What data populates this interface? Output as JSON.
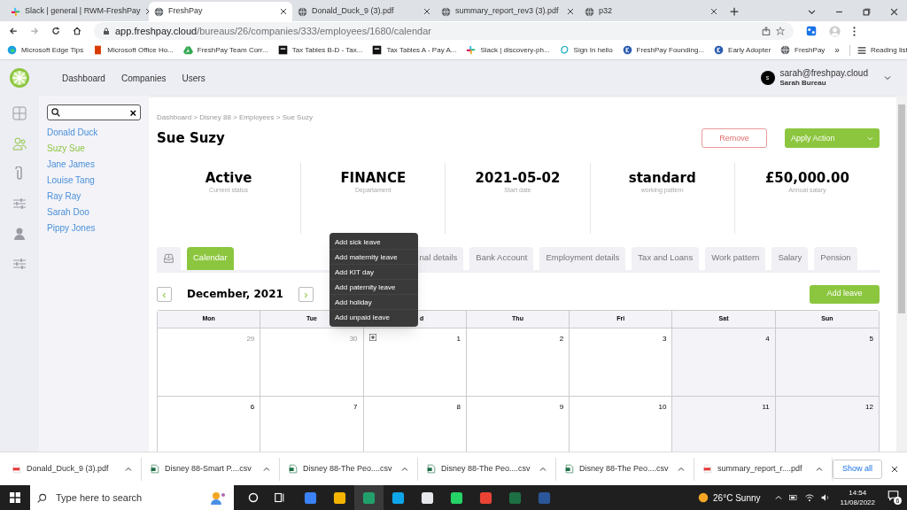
{
  "browser": {
    "tabs": [
      {
        "title": "Slack | general | RWM-FreshPay",
        "kind": "slack",
        "selected": false
      },
      {
        "title": "FreshPay",
        "kind": "globe",
        "selected": true
      },
      {
        "title": "Donald_Duck_9 (3).pdf",
        "kind": "globe",
        "selected": false
      },
      {
        "title": "summary_report_rev3 (3).pdf",
        "kind": "globe",
        "selected": false
      },
      {
        "title": "p32",
        "kind": "globe",
        "selected": false
      }
    ],
    "url_host": "app.freshpay.cloud",
    "url_path": "/bureaus/26/companies/333/employees/1680/calendar",
    "bookmarks": [
      {
        "label": "Microsoft Edge Tips",
        "kind": "edge"
      },
      {
        "label": "Microsoft Office Ho...",
        "kind": "office"
      },
      {
        "label": "FreshPay Team Corr...",
        "kind": "drive"
      },
      {
        "label": "Tax Tables B-D - Tax...",
        "kind": "dark"
      },
      {
        "label": "Tax Tables A - Pay A...",
        "kind": "dark"
      },
      {
        "label": "Slack | discovery-ph...",
        "kind": "slack"
      },
      {
        "label": "Sign In hello",
        "kind": "hello"
      },
      {
        "label": "FreshPay Founding...",
        "kind": "k"
      },
      {
        "label": "Early Adopter",
        "kind": "k"
      },
      {
        "label": "FreshPay",
        "kind": "globe"
      }
    ],
    "more": "»",
    "reading_list": "Reading list"
  },
  "app": {
    "nav": [
      "Dashboard",
      "Companies",
      "Users"
    ],
    "user": {
      "initial": "s",
      "email": "sarah@freshpay.cloud",
      "name": "Sarah Bureau"
    },
    "rail": [
      {
        "kind": "grid",
        "selected": false
      },
      {
        "kind": "people",
        "selected": true
      },
      {
        "kind": "clip",
        "selected": false
      },
      {
        "kind": "sliders",
        "selected": false
      },
      {
        "kind": "person",
        "selected": false
      },
      {
        "kind": "sliders",
        "selected": false
      }
    ],
    "search": {
      "clear": "×"
    },
    "employees": [
      {
        "name": "Donald Duck",
        "selected": false
      },
      {
        "name": "Suzy Sue",
        "selected": true
      },
      {
        "name": "Jane James",
        "selected": false
      },
      {
        "name": "Louise Tang",
        "selected": false
      },
      {
        "name": "Ray Ray",
        "selected": false
      },
      {
        "name": "Sarah Doo",
        "selected": false
      },
      {
        "name": "Pippy Jones",
        "selected": false
      }
    ]
  },
  "page": {
    "breadcrumb": "Dashboard > Disney 88 > Employees > Sue Suzy",
    "title": "Sue Suzy",
    "remove": "Remove",
    "apply": "Apply Action",
    "stats": [
      {
        "value": "Active",
        "label": "Current status"
      },
      {
        "value": "FINANCE",
        "label": "Departament"
      },
      {
        "value": "2021-05-02",
        "label": "Start date"
      },
      {
        "value": "standard",
        "label": "working pattern"
      },
      {
        "value": "£50,000.00",
        "label": "Annual salary"
      }
    ],
    "tabs": [
      {
        "label": "Calendar",
        "selected": true
      },
      {
        "label": "nal details",
        "selected": false
      },
      {
        "label": "Bank Account",
        "selected": false
      },
      {
        "label": "Employment details",
        "selected": false
      },
      {
        "label": "Tax and Loans",
        "selected": false
      },
      {
        "label": "Work pattern",
        "selected": false
      },
      {
        "label": "Salary",
        "selected": false
      },
      {
        "label": "Pension",
        "selected": false
      }
    ],
    "menu": [
      "Add sick leave",
      "Add maternity leave",
      "Add KIT day",
      "Add paternity leave",
      "Add holiday",
      "Add unpaid leave"
    ]
  },
  "calendar": {
    "prev": "‹",
    "next": "›",
    "month": "December, 2021",
    "add_leave": "Add leave",
    "weekdays": [
      {
        "label": "Mon",
        "covered": false
      },
      {
        "label": "Tue",
        "covered": false
      },
      {
        "label": "d",
        "covered": true
      },
      {
        "label": "Thu",
        "covered": false
      },
      {
        "label": "Fri",
        "covered": false
      },
      {
        "label": "Sat",
        "covered": false
      },
      {
        "label": "Sun",
        "covered": false
      }
    ],
    "weeks": [
      [
        {
          "day": "29",
          "other_month": true
        },
        {
          "day": "30",
          "other_month": true
        },
        {
          "day": "1",
          "other_month": false,
          "add": true
        },
        {
          "day": "2",
          "other_month": false
        },
        {
          "day": "3",
          "other_month": false
        },
        {
          "day": "4",
          "other_month": false
        },
        {
          "day": "5",
          "other_month": false
        }
      ],
      [
        {
          "day": "6",
          "other_month": false
        },
        {
          "day": "7",
          "other_month": false
        },
        {
          "day": "8",
          "other_month": false
        },
        {
          "day": "9",
          "other_month": false
        },
        {
          "day": "10",
          "other_month": false
        },
        {
          "day": "11",
          "other_month": false
        },
        {
          "day": "12",
          "other_month": false
        }
      ]
    ]
  },
  "downloads": {
    "items": [
      {
        "name": "Donald_Duck_9 (3).pdf",
        "kind": "pdf"
      },
      {
        "name": "Disney 88-Smart P....csv",
        "kind": "csv"
      },
      {
        "name": "Disney 88-The Peo....csv",
        "kind": "csv"
      },
      {
        "name": "Disney 88-The Peo....csv",
        "kind": "csv"
      },
      {
        "name": "Disney 88-The Peo....csv",
        "kind": "csv"
      },
      {
        "name": "summary_report_r....pdf",
        "kind": "pdf"
      }
    ],
    "show_all": "Show all"
  },
  "taskbar": {
    "search": "Type here to search",
    "apps": [
      {
        "color": "#3b82f6"
      },
      {
        "color": "#f5b400"
      },
      {
        "color": "#22a06b"
      },
      {
        "color": "#0ea5e9"
      },
      {
        "color": "#e5e7eb"
      },
      {
        "color": "#25d366"
      },
      {
        "color": "#ea4335"
      },
      {
        "color": "#1d7044"
      },
      {
        "color": "#2b579a"
      }
    ],
    "weather": "26°C Sunny",
    "time": "14:54",
    "date": "11/08/2022",
    "notifications": "6"
  }
}
